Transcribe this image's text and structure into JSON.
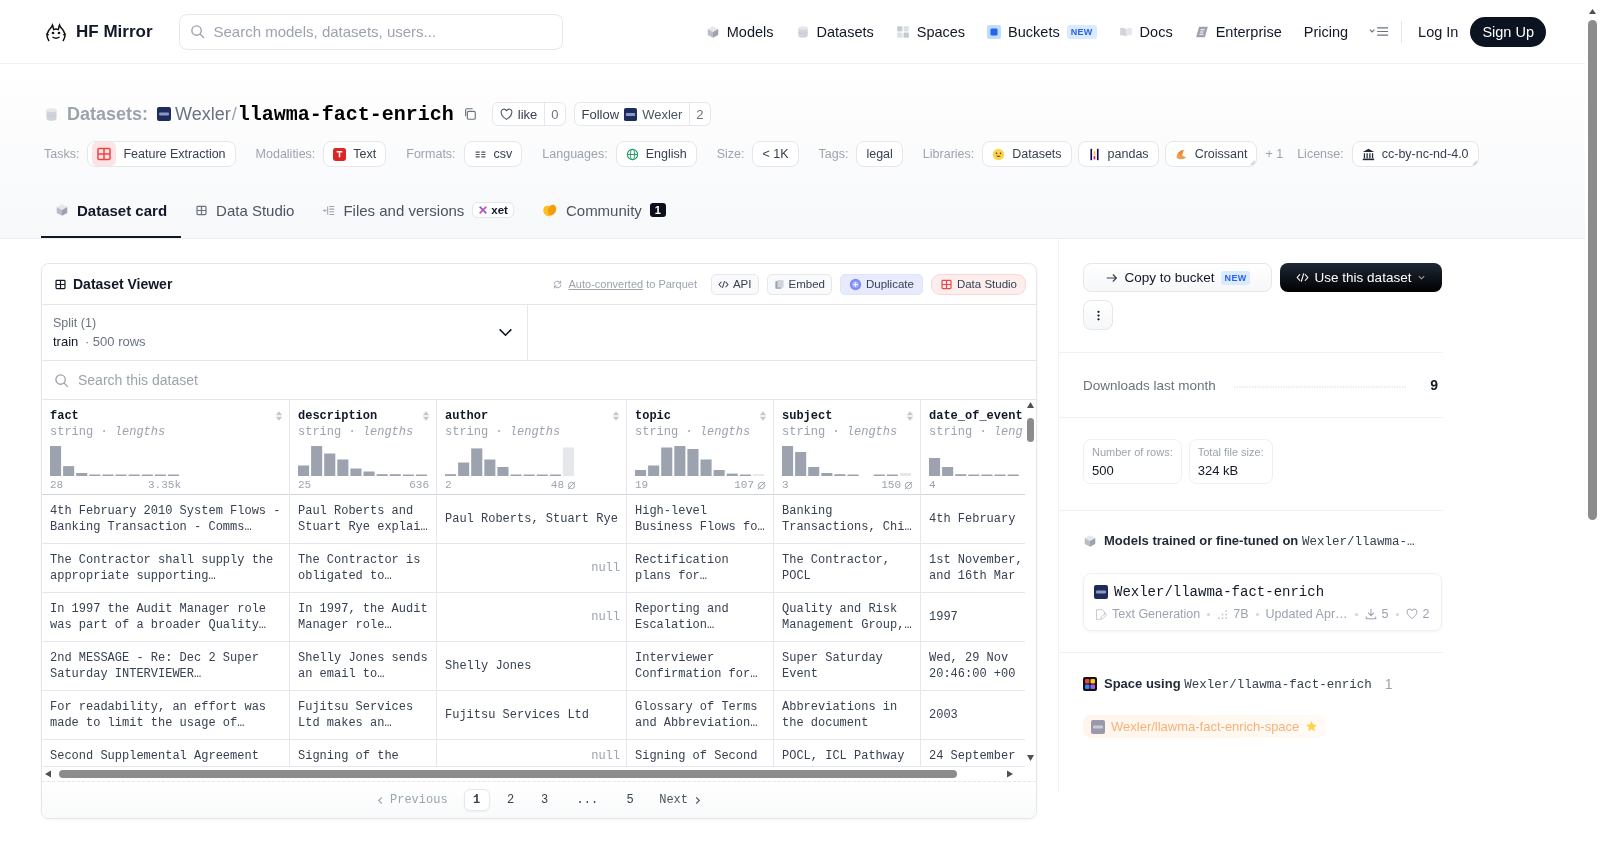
{
  "header": {
    "brand": "HF Mirror",
    "search": {
      "placeholder": "Search models, datasets, users..."
    },
    "nav": [
      {
        "label": "Models"
      },
      {
        "label": "Datasets"
      },
      {
        "label": "Spaces"
      },
      {
        "label": "Buckets",
        "badge": "NEW"
      },
      {
        "label": "Docs"
      },
      {
        "label": "Enterprise"
      },
      {
        "label": "Pricing"
      }
    ],
    "login": "Log In",
    "signup": "Sign Up"
  },
  "repo": {
    "type_label": "Datasets:",
    "owner": "Wexler",
    "separator": "/",
    "name": "llawma-fact-enrich",
    "like": {
      "label": "like",
      "count": "0"
    },
    "follow": {
      "label": "Follow",
      "user": "Wexler",
      "count": "2"
    }
  },
  "tag_groups": [
    {
      "label": "Tasks:",
      "chips": [
        {
          "text": "Feature Extraction",
          "menu": false
        }
      ]
    },
    {
      "label": "Modalities:",
      "chips": [
        {
          "text": "Text",
          "menu": false
        }
      ]
    },
    {
      "label": "Formats:",
      "chips": [
        {
          "text": "csv",
          "menu": false
        }
      ]
    },
    {
      "label": "Languages:",
      "chips": [
        {
          "text": "English",
          "menu": false
        }
      ]
    },
    {
      "label": "Size:",
      "chips": [
        {
          "text": "< 1K",
          "menu": false
        }
      ]
    },
    {
      "label": "Tags:",
      "chips": [
        {
          "text": "legal",
          "menu": false
        }
      ]
    },
    {
      "label": "Libraries:",
      "chips": [
        {
          "text": "Datasets",
          "menu": false
        },
        {
          "text": "pandas",
          "menu": false
        },
        {
          "text": "Croissant",
          "menu": true
        }
      ],
      "more": "+ 1"
    },
    {
      "label": "License:",
      "chips": [
        {
          "text": "cc-by-nc-nd-4.0",
          "menu": true
        }
      ]
    }
  ],
  "tabs": [
    {
      "label": "Dataset card",
      "selected": true
    },
    {
      "label": "Data Studio",
      "selected": false
    },
    {
      "label": "Files and versions",
      "badge": "xet",
      "selected": false
    },
    {
      "label": "Community",
      "count": "1",
      "selected": false
    }
  ],
  "viewer": {
    "title": "Dataset Viewer",
    "note": {
      "link": "Auto-converted",
      "text": "to Parquet"
    },
    "actions": [
      {
        "label": "API",
        "kind": "api"
      },
      {
        "label": "Embed",
        "kind": "embed"
      },
      {
        "label": "Duplicate",
        "kind": "duplicate"
      },
      {
        "label": "Data Studio",
        "kind": "studio"
      }
    ],
    "split": {
      "label": "Split (1)",
      "value": "train",
      "detail": "· 500 rows"
    },
    "search": {
      "placeholder": "Search this dataset"
    },
    "columns": [
      {
        "name": "fact",
        "type": "string · *lengths*",
        "min": "28",
        "max": "3.35k",
        "nulls": false,
        "sortable": true
      },
      {
        "name": "description",
        "type": "string · *lengths*",
        "min": "25",
        "max": "636",
        "nulls": false,
        "sortable": true
      },
      {
        "name": "author",
        "type": "string · *lengths*",
        "min": "2",
        "max": "48",
        "nulls": true,
        "sortable": true
      },
      {
        "name": "topic",
        "type": "string · *lengths*",
        "min": "19",
        "max": "107",
        "nulls": true,
        "sortable": true
      },
      {
        "name": "subject",
        "type": "string · *lengths*",
        "min": "3",
        "max": "150",
        "nulls": true,
        "sortable": true
      },
      {
        "name": "date_of_event",
        "type": "string · *leng*",
        "min": "4",
        "nulls": false,
        "sortable": false
      }
    ],
    "rows": [
      [
        {
          "text": "4th February 2010 System Flows - Banking Transaction - Comms…",
          "null": false
        },
        {
          "text": "Paul Roberts and Stuart Rye explai…",
          "null": false
        },
        {
          "text": "Paul Roberts, Stuart Rye",
          "null": false
        },
        {
          "text": "High-level Business Flows fo…",
          "null": false
        },
        {
          "text": "Banking Transactions, Chi…",
          "null": false
        },
        {
          "text": "4th February",
          "null": false
        }
      ],
      [
        {
          "text": "The Contractor shall supply the appropriate supporting…",
          "null": false
        },
        {
          "text": "The Contractor is obligated to…",
          "null": false
        },
        {
          "text": "null",
          "null": true
        },
        {
          "text": "Rectification plans for…",
          "null": false
        },
        {
          "text": "The Contractor, POCL",
          "null": false
        },
        {
          "text": "1st November, and 16th Mar",
          "null": false
        }
      ],
      [
        {
          "text": "In 1997 the Audit Manager role was part of a broader Quality…",
          "null": false
        },
        {
          "text": "In 1997, the Audit Manager role…",
          "null": false
        },
        {
          "text": "null",
          "null": true
        },
        {
          "text": "Reporting and Escalation…",
          "null": false
        },
        {
          "text": "Quality and Risk Management Group,…",
          "null": false
        },
        {
          "text": "1997",
          "null": false
        }
      ],
      [
        {
          "text": "2nd MESSAGE - Re: Dec 2 Super Saturday INTERVIEWER…",
          "null": false
        },
        {
          "text": "Shelly Jones sends an email to…",
          "null": false
        },
        {
          "text": "Shelly Jones",
          "null": false
        },
        {
          "text": "Interviewer Confirmation for…",
          "null": false
        },
        {
          "text": "Super Saturday Event",
          "null": false
        },
        {
          "text": "Wed, 29 Nov 20:46:00 +00",
          "null": false
        }
      ],
      [
        {
          "text": "For readability, an effort was made to limit the usage of…",
          "null": false
        },
        {
          "text": "Fujitsu Services Ltd makes an…",
          "null": false
        },
        {
          "text": "Fujitsu Services Ltd",
          "null": false
        },
        {
          "text": "Glossary of Terms and Abbreviation…",
          "null": false
        },
        {
          "text": "Abbreviations in the document",
          "null": false
        },
        {
          "text": "2003",
          "null": false
        }
      ],
      [
        {
          "text": "Second Supplemental Agreement",
          "null": false
        },
        {
          "text": "Signing of the",
          "null": false
        },
        {
          "text": "null",
          "null": true
        },
        {
          "text": "Signing of Second",
          "null": false
        },
        {
          "text": "POCL, ICL Pathway",
          "null": false
        },
        {
          "text": "24 September",
          "null": false
        }
      ]
    ],
    "pagination": {
      "previous": {
        "label": "Previous",
        "disabled": true
      },
      "pages": [
        {
          "label": "1",
          "kind": "page",
          "selected": true
        },
        {
          "label": "2",
          "kind": "page",
          "selected": false
        },
        {
          "label": "3",
          "kind": "page",
          "selected": false
        },
        {
          "label": "...",
          "kind": "gap",
          "selected": false
        },
        {
          "label": "5",
          "kind": "page",
          "selected": false
        }
      ],
      "next": {
        "label": "Next",
        "disabled": false
      }
    }
  },
  "sidebar": {
    "copy": {
      "label": "Copy to bucket",
      "badge": "NEW"
    },
    "use": {
      "label": "Use this dataset"
    },
    "downloads": {
      "label": "Downloads last month",
      "value": "9"
    },
    "stats": [
      {
        "label": "Number of rows:",
        "value": "500"
      },
      {
        "label": "Total file size:",
        "value": "324 kB"
      }
    ],
    "models": {
      "title": "Models trained or fine-tuned on",
      "repo": "Wexler/llawma-…",
      "items": [
        {
          "name": "Wexler/llawma-fact-enrich",
          "task": "Text Generation",
          "size": "7B",
          "updated": "Updated Apr…",
          "downloads": "5",
          "likes": "2"
        }
      ]
    },
    "spaces": {
      "title": "Space using",
      "repo": "Wexler/llawma-fact-enrich",
      "count": "1",
      "items": [
        {
          "name": "Wexler/llawma-fact-enrich-space"
        }
      ]
    }
  }
}
